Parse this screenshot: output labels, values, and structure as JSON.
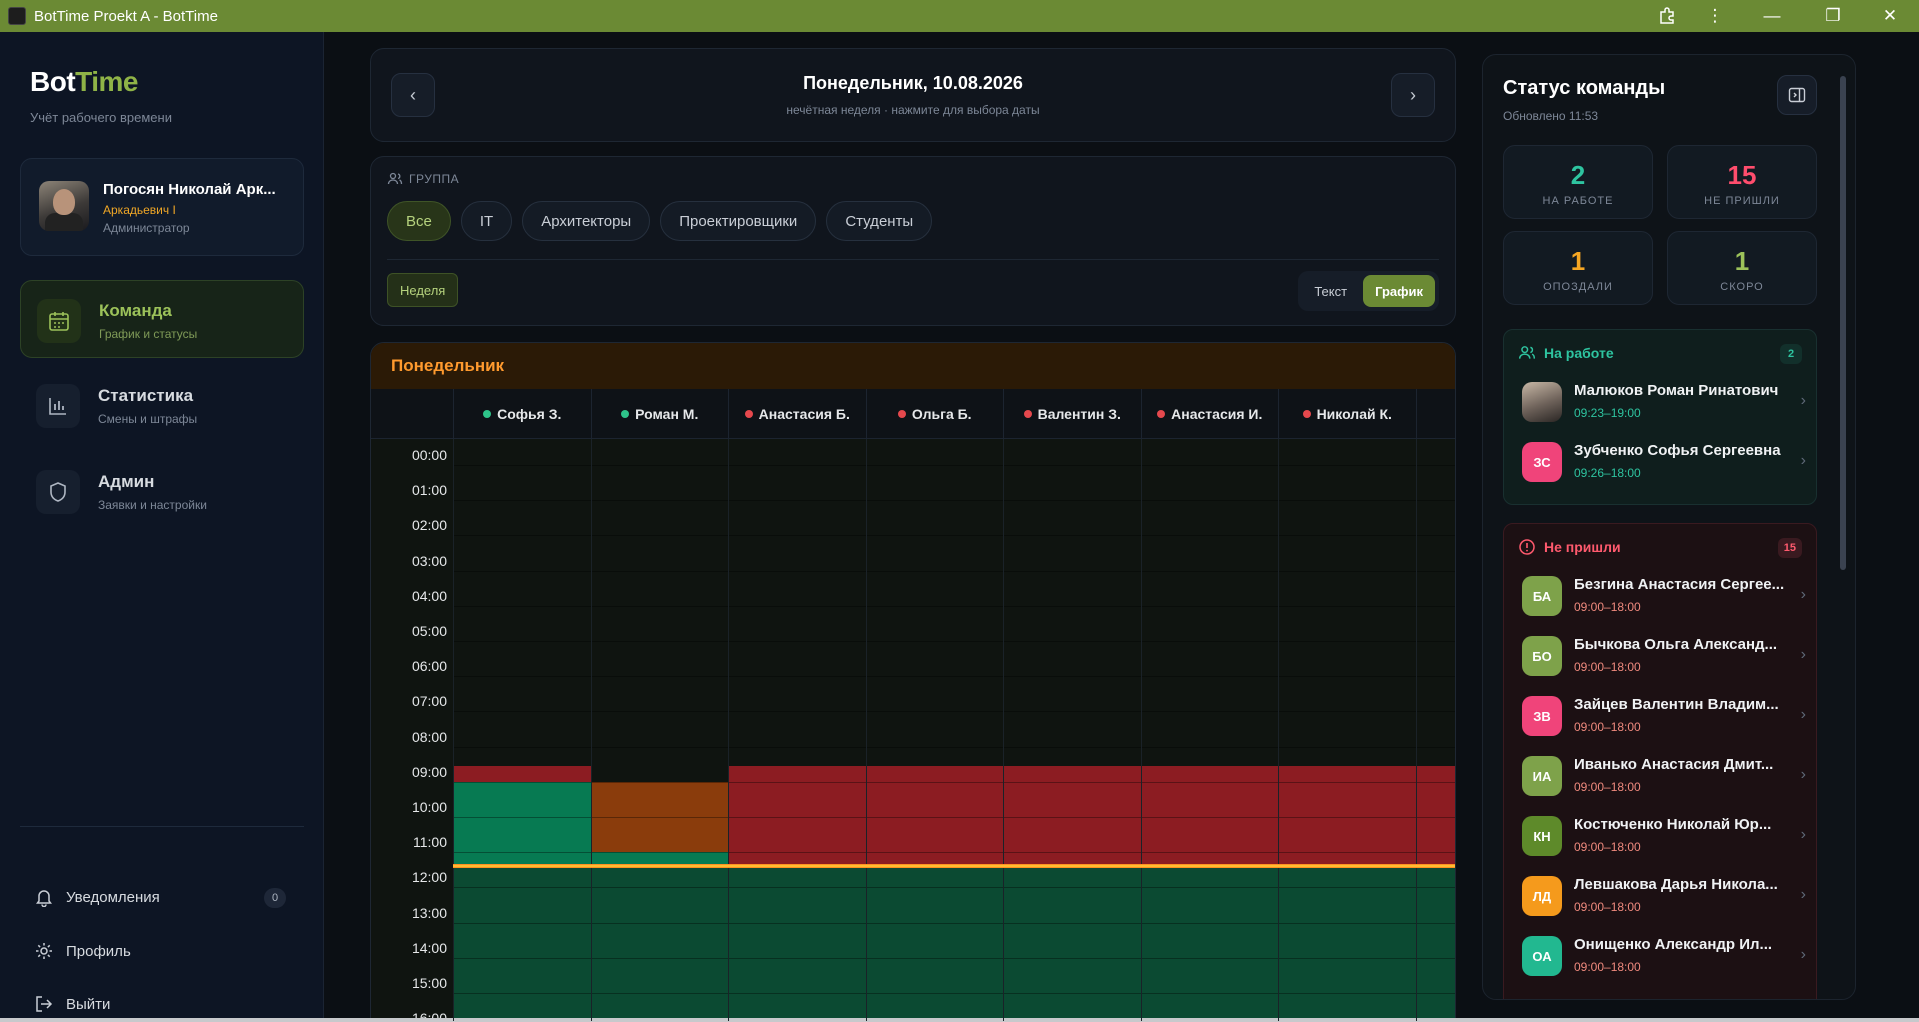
{
  "window": {
    "title": "BotTime Proekt A - BotTime"
  },
  "brand": {
    "part1": "Bot",
    "part2": "Time",
    "subtitle": "Учёт рабочего времени"
  },
  "user": {
    "name": "Погосян Николай Арк...",
    "subname": "Аркадьевич I",
    "role": "Администратор"
  },
  "nav": [
    {
      "title": "Команда",
      "sub": "График и статусы",
      "icon": "calendar-icon"
    },
    {
      "title": "Статистика",
      "sub": "Смены и штрафы",
      "icon": "bar-chart-icon"
    },
    {
      "title": "Админ",
      "sub": "Заявки и настройки",
      "icon": "shield-icon"
    }
  ],
  "bottom_nav": {
    "notifications": "Уведомления",
    "notifications_count": "0",
    "profile": "Профиль",
    "logout": "Выйти"
  },
  "date": {
    "title": "Понедельник, 10.08.2026",
    "sub": "нечётная неделя · нажмите для выбора даты",
    "prev": "‹",
    "next": "›"
  },
  "group": {
    "label": "ГРУППА",
    "chips": [
      "Все",
      "IT",
      "Архитекторы",
      "Проектировщики",
      "Студенты"
    ],
    "active": "Все",
    "week_label": "Неделя",
    "view_text": "Текст",
    "view_chart": "График"
  },
  "schedule": {
    "day": "Понедельник",
    "columns": [
      {
        "name": "Софья З.",
        "status": "green"
      },
      {
        "name": "Роман М.",
        "status": "green"
      },
      {
        "name": "Анастасия Б.",
        "status": "red"
      },
      {
        "name": "Ольга Б.",
        "status": "red"
      },
      {
        "name": "Валентин З.",
        "status": "red"
      },
      {
        "name": "Анастасия И.",
        "status": "red"
      },
      {
        "name": "Николай К.",
        "status": "red"
      },
      {
        "name": "",
        "status": "red"
      }
    ],
    "hours": [
      "00:00",
      "01:00",
      "02:00",
      "03:00",
      "04:00",
      "05:00",
      "06:00",
      "07:00",
      "08:00",
      "09:00",
      "10:00",
      "11:00",
      "12:00",
      "13:00",
      "14:00",
      "15:00",
      "16:00"
    ],
    "colors": {
      "absent": "#8c1c22",
      "worked": "#077a52",
      "late": "#8a3c0c",
      "planned": "#0b4a32",
      "empty": "#0f1410",
      "now_line": "#ffb020"
    }
  },
  "status": {
    "title": "Статус команды",
    "updated": "Обновлено 11:53",
    "stats": [
      {
        "num": "2",
        "label": "НА РАБОТЕ",
        "color": "#2ec4a0"
      },
      {
        "num": "15",
        "label": "НЕ ПРИШЛИ",
        "color": "#ff4d6d"
      },
      {
        "num": "1",
        "label": "ОПОЗДАЛИ",
        "color": "#f5a623"
      },
      {
        "num": "1",
        "label": "СКОРО",
        "color": "#9cc25a"
      }
    ],
    "working": {
      "title": "На работе",
      "count": "2",
      "people": [
        {
          "initials": "",
          "name": "Малюков Роман Ринатович",
          "time": "09:23–19:00",
          "color": "#6b6f78",
          "photo": true
        },
        {
          "initials": "ЗС",
          "name": "Зубченко Софья Сергеевна",
          "time": "09:26–18:00",
          "color": "#f0447a"
        }
      ]
    },
    "absent": {
      "title": "Не пришли",
      "count": "15",
      "people": [
        {
          "initials": "БА",
          "name": "Безгина Анастасия Сергее...",
          "time": "09:00–18:00",
          "color": "#7ea24a"
        },
        {
          "initials": "БО",
          "name": "Бычкова Ольга Александ...",
          "time": "09:00–18:00",
          "color": "#7ea24a"
        },
        {
          "initials": "ЗВ",
          "name": "Зайцев Валентин Владим...",
          "time": "09:00–18:00",
          "color": "#f0447a"
        },
        {
          "initials": "ИА",
          "name": "Иванько Анастасия Дмит...",
          "time": "09:00–18:00",
          "color": "#7ea24a"
        },
        {
          "initials": "КН",
          "name": "Костюченко Николай Юр...",
          "time": "09:00–18:00",
          "color": "#5e8a2a"
        },
        {
          "initials": "ЛД",
          "name": "Левшакова Дарья Никола...",
          "time": "09:00–18:00",
          "color": "#f59a1c"
        },
        {
          "initials": "ОА",
          "name": "Онищенко Александр Ил...",
          "time": "09:00–18:00",
          "color": "#22b890"
        }
      ]
    }
  }
}
